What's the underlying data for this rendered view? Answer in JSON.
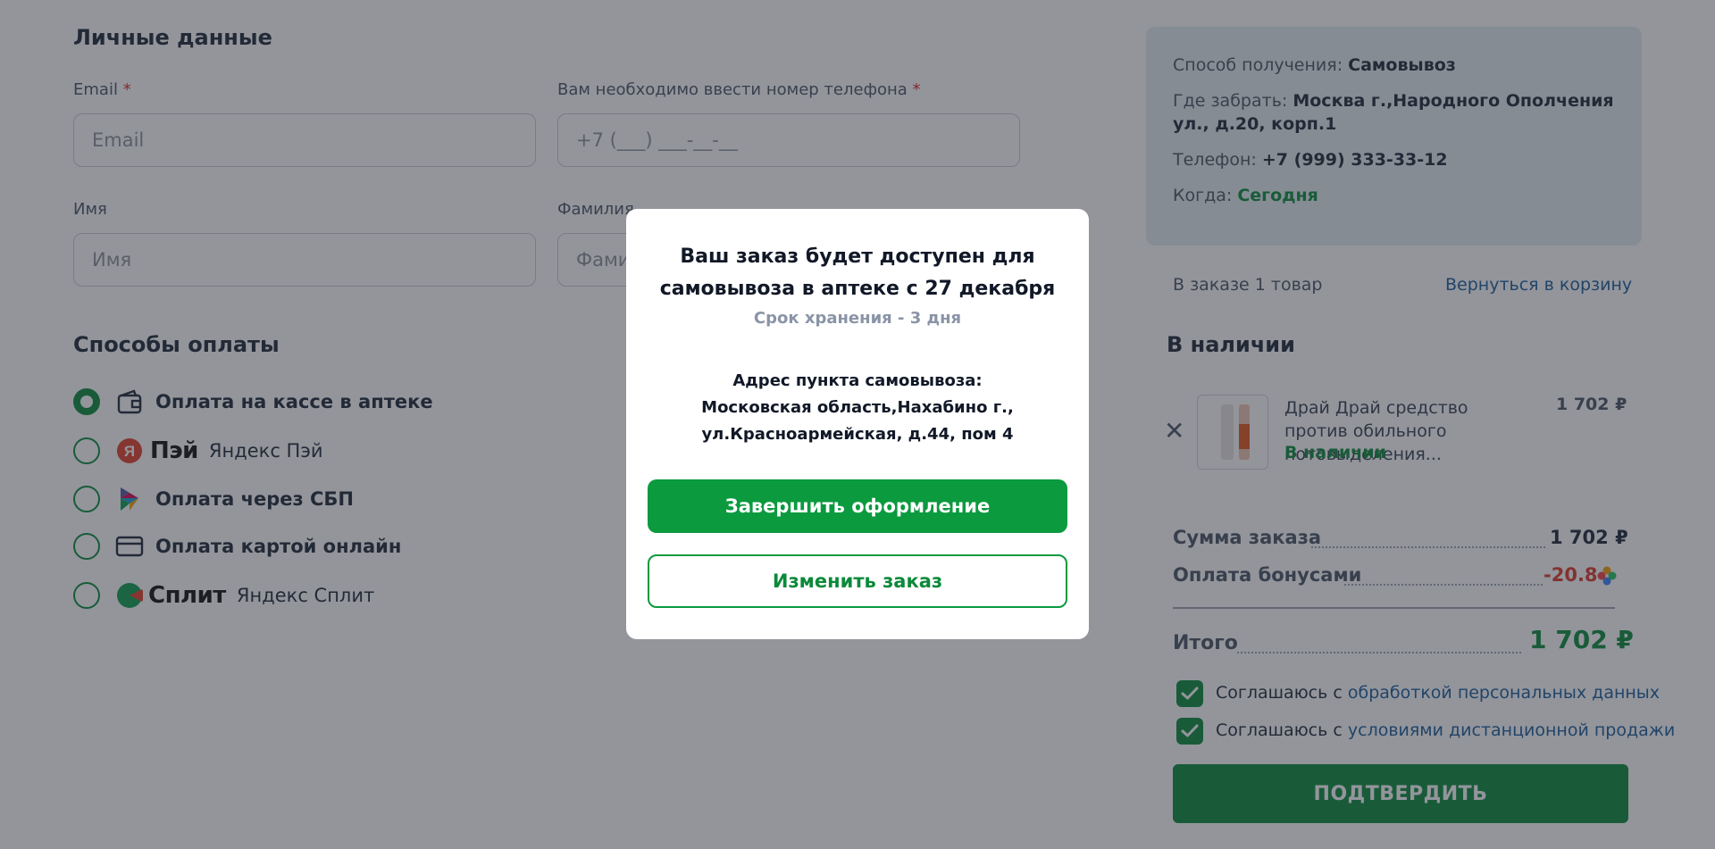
{
  "personal": {
    "title": "Личные данные",
    "email_label": "Email",
    "email_placeholder": "Email",
    "phone_label": "Вам необходимо ввести номер телефона",
    "phone_placeholder": "+7 (___) ___-__-__",
    "name_label": "Имя",
    "name_placeholder": "Имя",
    "surname_label": "Фамилия",
    "surname_placeholder": "Фамилия",
    "required_mark": "*"
  },
  "payment": {
    "title": "Способы оплаты",
    "options": [
      {
        "label": "Оплата на кассе в аптеке",
        "selected": true,
        "icon": "wallet-icon"
      },
      {
        "brand": "Пэй",
        "label": "Яндекс Пэй",
        "selected": false,
        "icon": "yandex-pay-icon"
      },
      {
        "label": "Оплата через СБП",
        "selected": false,
        "icon": "sbp-icon"
      },
      {
        "label": "Оплата картой онлайн",
        "selected": false,
        "icon": "card-icon"
      },
      {
        "brand": "Сплит",
        "label": "Яндекс Сплит",
        "selected": false,
        "icon": "yandex-split-icon"
      }
    ]
  },
  "delivery": {
    "method_label": "Способ получения:",
    "method_value": "Самовывоз",
    "where_label": "Где забрать:",
    "where_value": "Москва г.,Народного Ополчения ул., д.20, корп.1",
    "phone_label": "Телефон:",
    "phone_value": "+7 (999) 333-33-12",
    "when_label": "Когда:",
    "when_value": "Сегодня"
  },
  "order": {
    "items_count": "В заказе 1 товар",
    "back_link": "Вернуться в корзину",
    "availability_title": "В наличии",
    "product": {
      "name": "Драй Драй средство против обильного потовыделения...",
      "status": "В наличии",
      "price": "1 702 ₽"
    },
    "sum_label": "Сумма заказа",
    "sum_value": "1 702 ₽",
    "bonus_label": "Оплата бонусами",
    "bonus_value": "-20.8",
    "total_label": "Итого",
    "total_value": "1 702 ₽",
    "agree1_prefix": "Соглашаюсь с",
    "agree1_link": "обработкой персональных данных",
    "agree2_prefix": "Соглашаюсь с",
    "agree2_link": "условиями дистанционной продажи",
    "confirm_label": "ПОДТВЕРДИТЬ"
  },
  "modal": {
    "title": "Ваш заказ будет доступен для самовывоза в аптеке с 27 декабря",
    "storage": "Срок хранения - 3 дня",
    "address_label": "Адрес пункта самовывоза:",
    "address_value": "Московская область,Нахабино г., ул.Красноармейская, д.44, пом 4",
    "primary_button": "Завершить оформление",
    "secondary_button": "Изменить заказ"
  },
  "colors": {
    "accent": "#0b8a3a",
    "link": "#1a5c98",
    "bonus": "#dc3b2b"
  }
}
